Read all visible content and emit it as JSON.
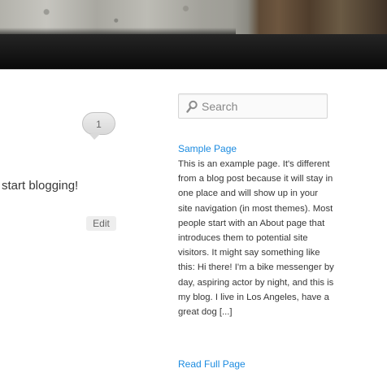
{
  "comments": {
    "count": "1"
  },
  "post": {
    "text": "start blogging!",
    "edit_label": "Edit"
  },
  "search": {
    "placeholder": "Search"
  },
  "widget": {
    "page_title": "Sample Page",
    "excerpt": "This is an example page. It's different from a blog post because it will stay in one place and will show up in your site navigation (in most themes). Most people start with an About page that introduces them to potential site visitors. It might say something like this: Hi there! I'm a bike messenger by day, aspiring actor by night, and this is my blog. I live in Los Angeles, have a great dog [...]",
    "read_more": "Read Full Page"
  },
  "colors": {
    "link": "#1b8be0",
    "nav_bar": "#0a0a0a",
    "text": "#373737"
  },
  "icons": {
    "search": "search-icon"
  }
}
